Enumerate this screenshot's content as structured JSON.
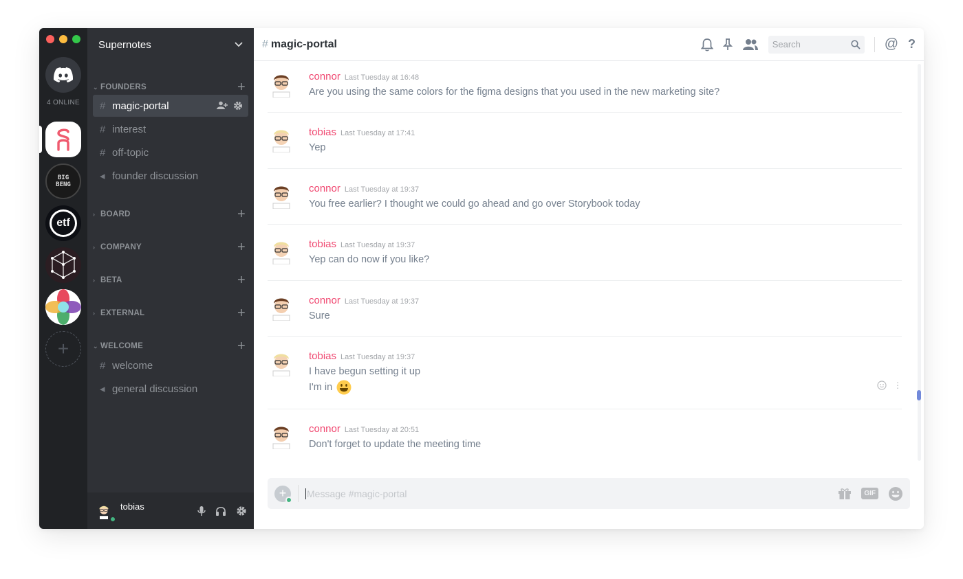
{
  "rail": {
    "online_label": "4 ONLINE",
    "servers": [
      {
        "name": "discord-home"
      },
      {
        "name": "supernotes",
        "initials": "S"
      },
      {
        "name": "big-beng",
        "initials": "BIG BENG"
      },
      {
        "name": "etf",
        "initials": "etf"
      },
      {
        "name": "cube"
      },
      {
        "name": "colors"
      }
    ]
  },
  "sidebar": {
    "guild_name": "Supernotes",
    "categories": [
      {
        "label": "FOUNDERS",
        "expanded": true
      },
      {
        "label": "BOARD",
        "expanded": false
      },
      {
        "label": "COMPANY",
        "expanded": false
      },
      {
        "label": "BETA",
        "expanded": false
      },
      {
        "label": "EXTERNAL",
        "expanded": false
      },
      {
        "label": "WELCOME",
        "expanded": true
      }
    ],
    "channels": [
      {
        "label": "magic-portal",
        "type": "locked-text",
        "active": true
      },
      {
        "label": "interest",
        "type": "locked-text"
      },
      {
        "label": "off-topic",
        "type": "locked-text"
      },
      {
        "label": "founder discussion",
        "type": "locked-voice"
      },
      {
        "label": "welcome",
        "type": "text"
      },
      {
        "label": "general discussion",
        "type": "voice"
      }
    ],
    "user": {
      "name": "tobias",
      "status": "online"
    }
  },
  "header": {
    "channel": "magic-portal",
    "search_placeholder": "Search"
  },
  "messages": [
    {
      "author": "connor",
      "time": "Last Tuesday at 16:48",
      "lines": [
        "Are you using the same colors for the figma designs that you used in the new marketing site?"
      ]
    },
    {
      "author": "tobias",
      "time": "Last Tuesday at 17:41",
      "lines": [
        "Yep"
      ]
    },
    {
      "author": "connor",
      "time": "Last Tuesday at 19:37",
      "lines": [
        "You free earlier? I thought we could go ahead and go over Storybook today"
      ]
    },
    {
      "author": "tobias",
      "time": "Last Tuesday at 19:37",
      "lines": [
        "Yep can do now if you like?"
      ]
    },
    {
      "author": "connor",
      "time": "Last Tuesday at 19:37",
      "lines": [
        "Sure"
      ]
    },
    {
      "author": "tobias",
      "time": "Last Tuesday at 19:37",
      "lines": [
        "I have begun setting it up",
        "I'm in"
      ]
    },
    {
      "author": "connor",
      "time": "Last Tuesday at 20:51",
      "lines": [
        "Don't forget to update the meeting time"
      ]
    }
  ],
  "composer": {
    "placeholder": "Message #magic-portal",
    "gif_label": "GIF"
  },
  "colors": {
    "author": "#f04770",
    "accent": "#7289da",
    "online": "#43b581"
  }
}
